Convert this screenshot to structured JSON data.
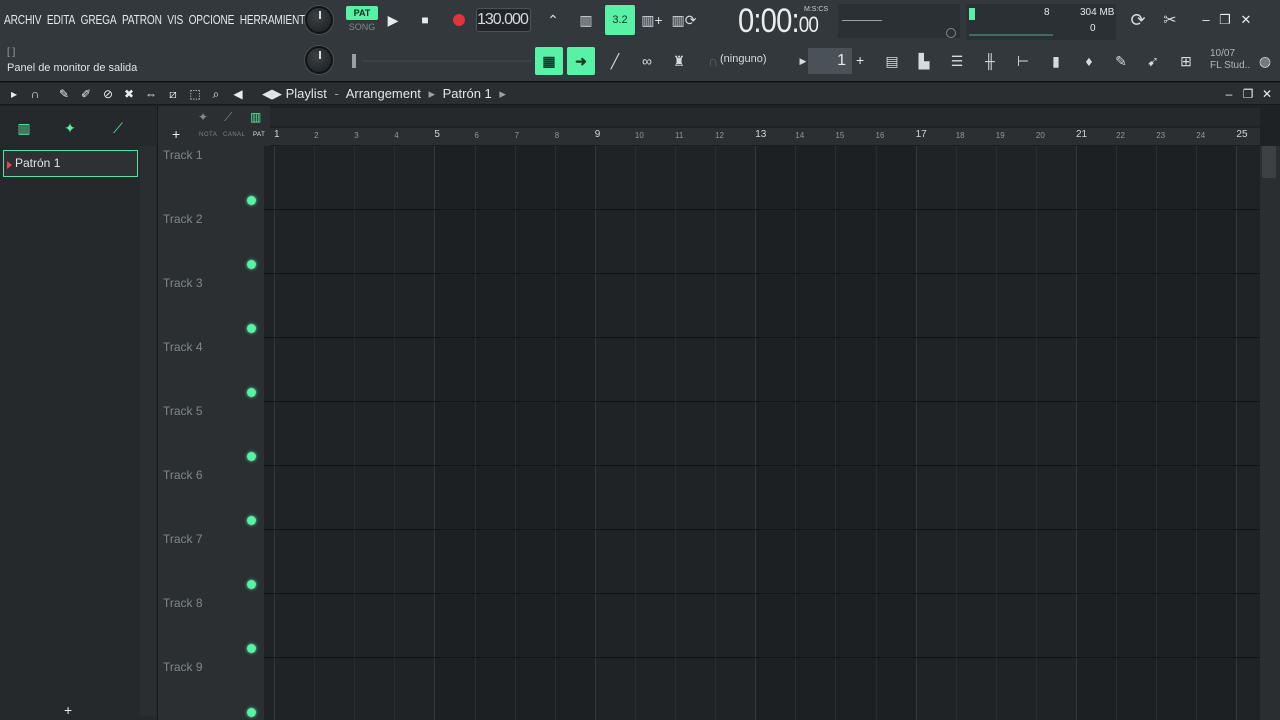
{
  "menu": [
    "ARCHIV",
    "EDITA",
    "GREGA",
    "PATRON",
    "VIS",
    "OPCIONE",
    "HERRAMIENTA"
  ],
  "hint": {
    "brackets": "[ ]",
    "text": "Panel de monitor de salida"
  },
  "transport": {
    "pat_label": "PAT",
    "song_label": "SONG",
    "tempo": "130.000",
    "play_icon": "play-icon",
    "stop_icon": "stop-icon",
    "record_icon": "record-icon"
  },
  "time": {
    "main": "0:00",
    "cs": "00",
    "unit": "M:S:CS"
  },
  "cpu": {
    "voices": "8",
    "memory": "304 MB",
    "cpu": "0"
  },
  "snap": {
    "value": "(ninguno)"
  },
  "pattern_selector": {
    "value": "1"
  },
  "date": {
    "line1": "10/07",
    "line2": "FL Stud.."
  },
  "playlist": {
    "title": "Playlist",
    "view": "Arrangement",
    "pattern": "Patrón 1"
  },
  "picker": {
    "item": "Patrón 1"
  },
  "track_header": {
    "nota": "NOTA",
    "canal": "CANAL",
    "pat": "PAT"
  },
  "ruler": [
    "1",
    "2",
    "3",
    "4",
    "5",
    "6",
    "7",
    "8",
    "9",
    "10",
    "11",
    "12",
    "13",
    "14",
    "15",
    "16",
    "17",
    "18",
    "19",
    "20",
    "21",
    "22",
    "23",
    "24",
    "25"
  ],
  "tracks": [
    "Track 1",
    "Track 2",
    "Track 3",
    "Track 4",
    "Track 5",
    "Track 6",
    "Track 7",
    "Track 8",
    "Track 9"
  ],
  "colors": {
    "accent": "#58f2a6",
    "background": "#1f2224",
    "toolbar": "#33383c"
  }
}
